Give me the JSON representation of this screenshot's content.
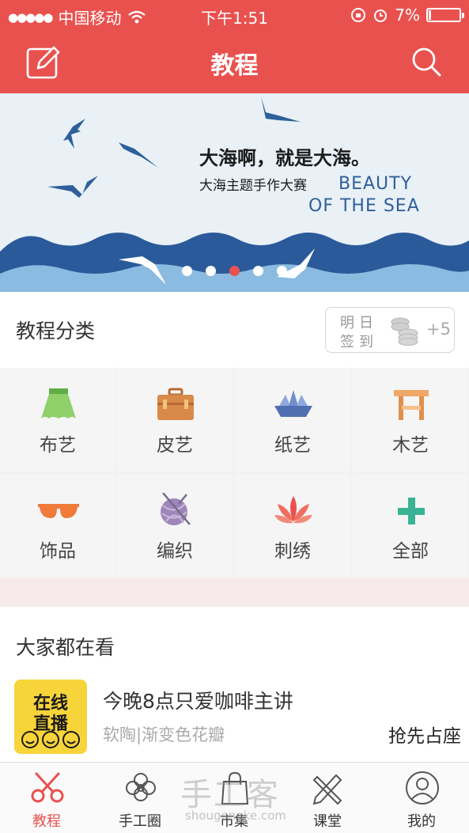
{
  "status_bar": {
    "carrier": "中国移动",
    "time": "下午1:51",
    "battery_percent": "7%",
    "battery_level": 0.07
  },
  "nav": {
    "title": "教程",
    "left_icon": "edit-icon",
    "right_icon": "search-icon"
  },
  "banner": {
    "headline": "大海啊，就是大海。",
    "subtitle": "大海主题手作大赛",
    "english_line1": "BEAUTY",
    "english_line2": "OF THE SEA",
    "dots_count": 5,
    "active_dot": 2
  },
  "categories": {
    "header": "教程分类",
    "checkin": {
      "line1": "明日",
      "line2": "签到",
      "bonus": "+5",
      "icon": "coins-icon"
    },
    "items": [
      {
        "label": "布艺",
        "icon": "skirt-icon",
        "color": "#7dc45e"
      },
      {
        "label": "皮艺",
        "icon": "briefcase-icon",
        "color": "#d98a4a"
      },
      {
        "label": "纸艺",
        "icon": "paper-boat-icon",
        "color": "#6f8fc9"
      },
      {
        "label": "木艺",
        "icon": "stool-icon",
        "color": "#f0a868"
      },
      {
        "label": "饰品",
        "icon": "sunglasses-icon",
        "color": "#f07a3a"
      },
      {
        "label": "编织",
        "icon": "yarn-ball-icon",
        "color": "#9e86b8"
      },
      {
        "label": "刺绣",
        "icon": "lotus-icon",
        "color": "#e9514f"
      },
      {
        "label": "全部",
        "icon": "plus-icon",
        "color": "#3ab394"
      }
    ]
  },
  "popular": {
    "header": "大家都在看",
    "item": {
      "thumb_line1": "在线",
      "thumb_line2": "直播",
      "title": "今晚8点只爱咖啡主讲",
      "subtitle": "软陶|渐变色花瓣",
      "action": "抢先占座"
    }
  },
  "tabbar": {
    "tabs": [
      {
        "label": "教程",
        "icon": "scissors-icon",
        "active": true
      },
      {
        "label": "手工圈",
        "icon": "flower-icon",
        "active": false
      },
      {
        "label": "市集",
        "icon": "shopping-bag-icon",
        "active": false
      },
      {
        "label": "课堂",
        "icon": "pencil-ruler-icon",
        "active": false
      },
      {
        "label": "我的",
        "icon": "user-icon",
        "active": false
      }
    ]
  },
  "watermark": {
    "text": "手工客",
    "url": "shougongke.com"
  },
  "colors": {
    "brand": "#e9514f",
    "sea_dark": "#2e5f9b",
    "sea_light": "#8bbbe0"
  }
}
